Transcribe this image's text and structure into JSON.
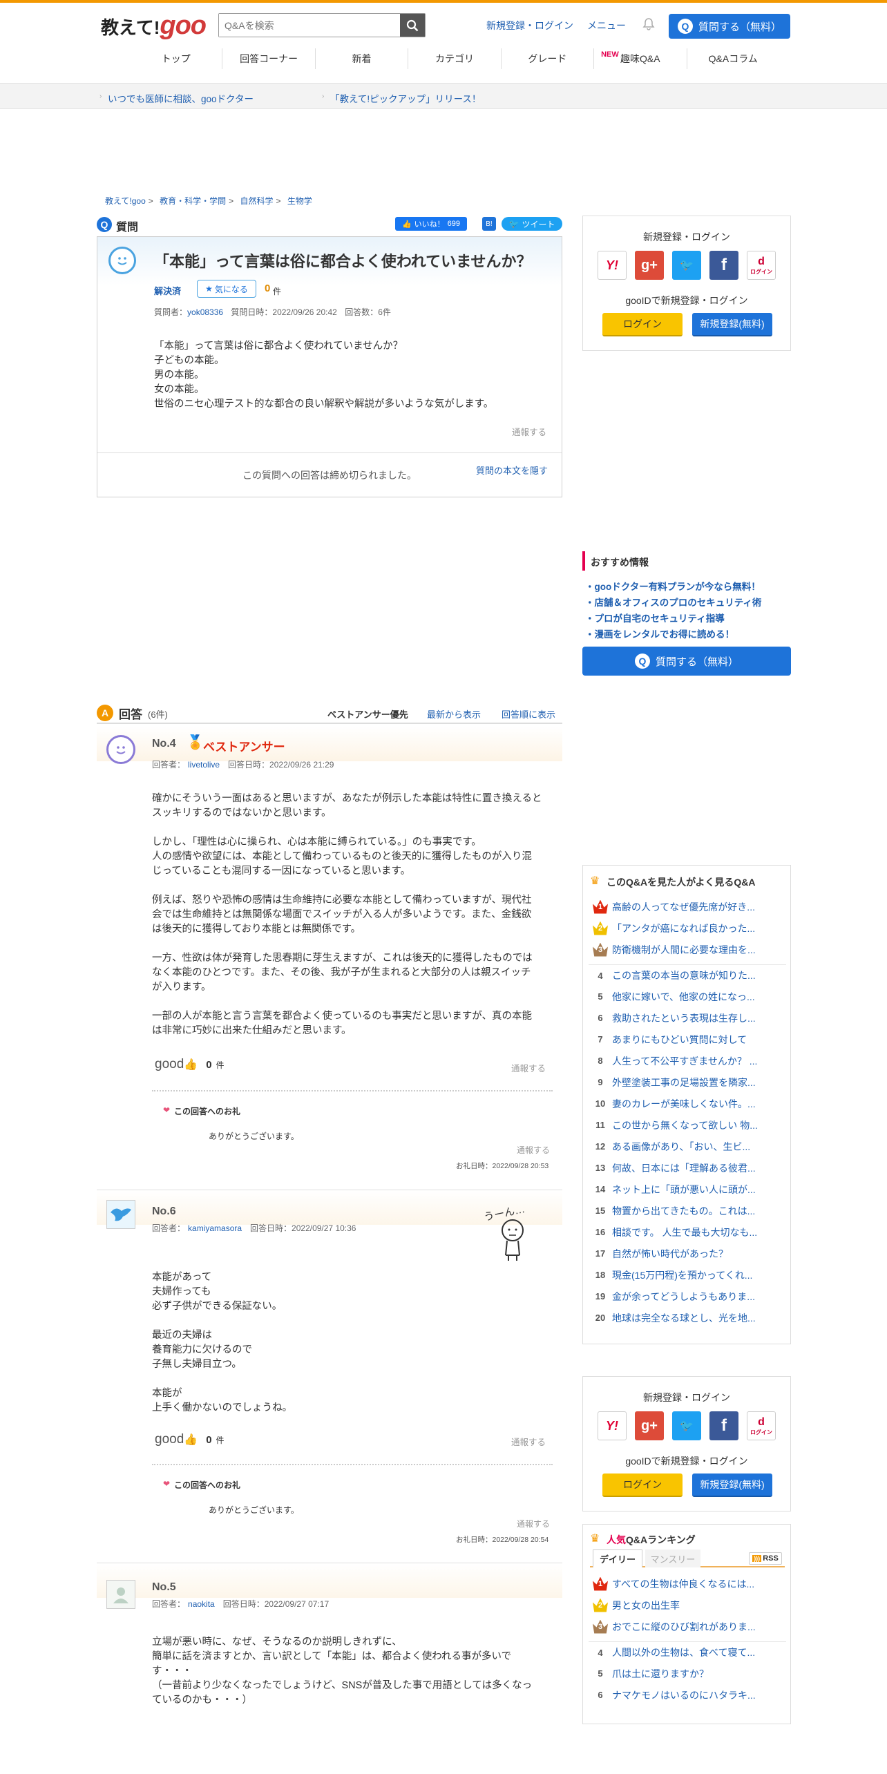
{
  "header": {
    "logo_main": "教えて!",
    "logo_goo": "goo",
    "search_placeholder": "Q&Aを検索",
    "login_link": "新規登録・ログイン",
    "menu_link": "メニュー",
    "ask_button": "質問する（無料）"
  },
  "gnav": [
    "トップ",
    "回答コーナー",
    "新着",
    "カテゴリ",
    "グレード",
    "趣味Q&A",
    "Q&Aコラム"
  ],
  "gnav_new": "NEW",
  "infobar": [
    "いつでも医師に相談、gooドクター",
    "「教えて!ピックアップ」リリース！"
  ],
  "breadcrumb": [
    "教えて!goo",
    "教育・科学・学問",
    "自然科学",
    "生物学"
  ],
  "question": {
    "section_label": "質問",
    "like_label": "いいね！",
    "like_count": "699",
    "tweet": "ツイート",
    "title": "「本能」って言葉は俗に都合よく使われていませんか？",
    "status": "解決済",
    "watch": "気になる",
    "watch_count": "0",
    "watch_unit": "件",
    "meta_asker_label": "質問者：",
    "asker": "yok08336",
    "meta_date": "質問日時：2022/09/26 20:42",
    "meta_count": "回答数：6件",
    "body": [
      "「本能」って言葉は俗に都合よく使われていませんか？",
      "子どもの本能。",
      "男の本能。",
      "女の本能。",
      "世俗のニセ心理テスト的な都合の良い解釈や解説が多いような気がします。"
    ],
    "report": "通報する",
    "closed": "この質問への回答は締め切られました。",
    "hide": "質問の本文を隠す"
  },
  "sidebar_login": {
    "title": "新規登録・ログイン",
    "gooid": "gooIDで新規登録・ログイン",
    "login": "ログイン",
    "register": "新規登録(無料)",
    "docomo": "ログイン"
  },
  "recommend": {
    "title": "おすすめ情報",
    "items": [
      "・gooドクター有料プランが今なら無料！",
      "・店舗＆オフィスのプロのセキュリティ術",
      "・プロが自宅のセキュリティ指導",
      "・漫画をレンタルでお得に読める！"
    ],
    "ask_button": "質問する（無料）"
  },
  "answers_header": {
    "label": "回答",
    "count": "(6件)",
    "sort_best": "ベストアンサー優先",
    "sort_new": "最新から表示",
    "sort_order": "回答順に表示"
  },
  "answer4": {
    "no": "No.4",
    "best": "ベストアンサー",
    "meta_label": "回答者：",
    "user": "livetolive",
    "date": "回答日時：2022/09/26 21:29",
    "body": [
      "確かにそういう一面はあると思いますが、あなたが例示した本能は特性に置き換えると",
      "スッキリするのではないかと思います。",
      "",
      "しかし、「理性は心に操られ、心は本能に縛られている。」のも事実です。",
      "人の感情や欲望には、本能として備わっているものと後天的に獲得したものが入り混",
      "じっていることも混同する一因になっていると思います。",
      "",
      "例えば、怒りや恐怖の感情は生命維持に必要な本能として備わっていますが、現代社",
      "会では生命維持とは無関係な場面でスイッチが入る人が多いようです。また、金銭欲",
      "は後天的に獲得しており本能とは無関係です。",
      "",
      "一方、性欲は体が発育した思春期に芽生えますが、これは後天的に獲得したものでは",
      "なく本能のひとつです。また、その後、我が子が生まれると大部分の人は親スイッチ",
      "が入ります。",
      "",
      "一部の人が本能と言う言葉を都合よく使っているのも事実だと思いますが、真の本能",
      "は非常に巧妙に出来た仕組みだと思います。"
    ],
    "good": "good",
    "good_count": "0",
    "good_unit": "件",
    "report": "通報する",
    "thanks_title": "この回答へのお礼",
    "thanks_body": "ありがとうございます。",
    "thanks_report": "通報する",
    "thanks_date": "お礼日時：2022/09/28 20:53"
  },
  "answer6": {
    "no": "No.6",
    "meta_label": "回答者：",
    "user": "kamiyamasora",
    "date": "回答日時：2022/09/27 10:36",
    "body": [
      "本能があって",
      "夫婦作っても",
      "必ず子供ができる保証ない。",
      "",
      "最近の夫婦は",
      "養育能力に欠けるので",
      "子無し夫婦目立つ。",
      "",
      "本能が",
      "上手く働かないのでしょうね。"
    ],
    "good": "good",
    "good_count": "0",
    "good_unit": "件",
    "report": "通報する",
    "thanks_title": "この回答へのお礼",
    "thanks_body": "ありがとうございます。",
    "thanks_report": "通報する",
    "thanks_date": "お礼日時：2022/09/28 20:54",
    "doodle_text": "うーん…"
  },
  "answer5": {
    "no": "No.5",
    "meta_label": "回答者：",
    "user": "naokita",
    "date": "回答日時：2022/09/27 07:17",
    "body": [
      "立場が悪い時に、なぜ、そうなるのか説明しきれずに、",
      "簡単に話を済ますとか、言い訳として「本能」は、都合よく使われる事が多いで",
      "す・・・",
      "（一昔前より少なくなったでしょうけど、SNSが普及した事で用語としては多くなっ",
      "ているのかも・・・）"
    ]
  },
  "also_viewed": {
    "title": "このQ&Aを見た人がよく見るQ&A",
    "items": [
      "高齢の人ってなぜ優先席が好き...",
      "「アンタが癌になれば良かった...",
      "防衛機制が人間に必要な理由を...",
      "この言葉の本当の意味が知りた...",
      "他家に嫁いで、他家の姓になっ...",
      "救助されたという表現は生存し...",
      "あまりにもひどい質問に対して",
      "人生って不公平すぎませんか？ ...",
      "外壁塗装工事の足場設置を隣家...",
      "妻のカレーが美味しくない件。...",
      "この世から無くなって欲しい 物...",
      "ある画像があり、「おい、生ビ...",
      "何故、日本には「理解ある彼君...",
      "ネット上に「頭が悪い人に頭が...",
      "物置から出てきたもの。これは...",
      "相談です。 人生で最も大切なも...",
      "自然が怖い時代があった？",
      "現金(15万円程)を預かってくれ...",
      "金が余ってどうしようもありま...",
      "地球は完全なる球とし、光を地..."
    ],
    "numbers": [
      "1",
      "2",
      "3",
      "4",
      "5",
      "6",
      "7",
      "8",
      "9",
      "10",
      "11",
      "12",
      "13",
      "14",
      "15",
      "16",
      "17",
      "18",
      "19",
      "20"
    ]
  },
  "ranking": {
    "title_pink": "人気",
    "title_rest": "Q&Aランキング",
    "tab_daily": "デイリー",
    "tab_monthly": "マンスリー",
    "rss": "RSS",
    "items": [
      "すべての生物は仲良くなるには...",
      "男と女の出生率",
      "おでこに縦のひび割れがありま...",
      "人間以外の生物は、食べて寝て...",
      "爪は土に還りますか？",
      "ナマケモノはいるのにハタラキ..."
    ],
    "numbers": [
      "1",
      "2",
      "3",
      "4",
      "5",
      "6"
    ]
  },
  "colors": {
    "accent": "#f39800",
    "link": "#1f5fb0",
    "primary": "#1e73d9",
    "best": "#e0280f"
  }
}
